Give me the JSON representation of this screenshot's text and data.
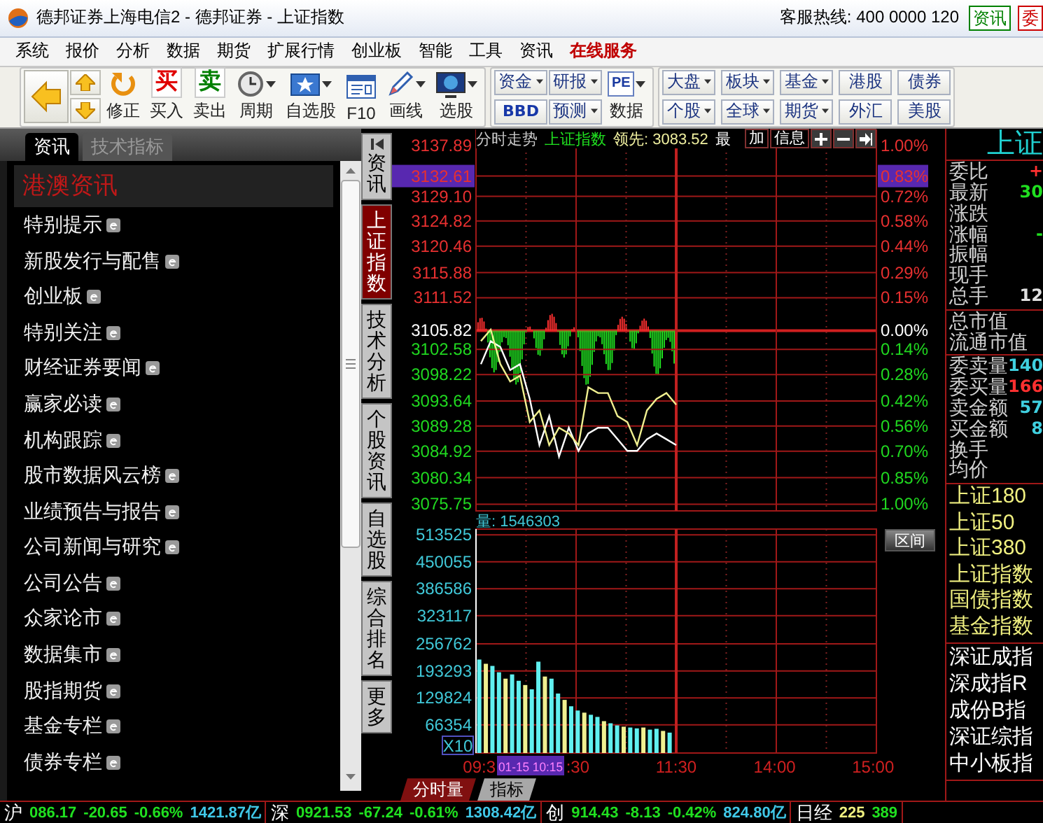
{
  "window": {
    "title": "德邦证券上海电信2 - 德邦证券 - 上证指数",
    "hotline": "客服热线: 400 0000 120",
    "buttons": [
      {
        "label": "资讯",
        "color": "#008000"
      },
      {
        "label": "委",
        "color": "#cc0000"
      }
    ]
  },
  "menu": [
    {
      "label": "系统",
      "highlighted": false
    },
    {
      "label": "报价",
      "highlighted": false
    },
    {
      "label": "分析",
      "highlighted": false
    },
    {
      "label": "数据",
      "highlighted": false
    },
    {
      "label": "期货",
      "highlighted": false
    },
    {
      "label": "扩展行情",
      "highlighted": false
    },
    {
      "label": "创业板",
      "highlighted": false
    },
    {
      "label": "智能",
      "highlighted": false
    },
    {
      "label": "工具",
      "highlighted": false
    },
    {
      "label": "资讯",
      "highlighted": false
    },
    {
      "label": "在线服务",
      "highlighted": true
    }
  ],
  "toolbar": {
    "tools": [
      {
        "kind": "back"
      },
      {
        "kind": "updown"
      },
      {
        "kind": "refresh",
        "label": "修正",
        "dropdown": false
      },
      {
        "kind": "buy",
        "glyph": "买",
        "label": "买入",
        "dropdown": false
      },
      {
        "kind": "sell",
        "glyph": "卖",
        "label": "卖出",
        "dropdown": false
      },
      {
        "kind": "clock",
        "label": "周期",
        "dropdown": true
      },
      {
        "kind": "star",
        "label": "自选股",
        "dropdown": true
      },
      {
        "kind": "doc",
        "label": "F10",
        "dropdown": false
      },
      {
        "kind": "pencil",
        "label": "画线",
        "dropdown": true
      },
      {
        "kind": "screen",
        "label": "选股",
        "dropdown": true
      }
    ],
    "small": [
      [
        {
          "label": "资金",
          "dropdown": true,
          "bold": false
        },
        {
          "label": "BBD",
          "dropdown": false,
          "bold": true
        }
      ],
      [
        {
          "label": "研报",
          "dropdown": true,
          "bold": false
        },
        {
          "label": "预测",
          "dropdown": true,
          "bold": false
        }
      ]
    ],
    "data_tool": {
      "glyph": "PE",
      "label": "数据",
      "dropdown": true
    },
    "markets": [
      [
        {
          "label": "大盘",
          "dropdown": true,
          "bold": false
        },
        {
          "label": "个股",
          "dropdown": true,
          "bold": false
        }
      ],
      [
        {
          "label": "板块",
          "dropdown": true,
          "bold": false
        },
        {
          "label": "全球",
          "dropdown": true,
          "bold": false
        }
      ],
      [
        {
          "label": "基金",
          "dropdown": true,
          "bold": false
        },
        {
          "label": "期货",
          "dropdown": true,
          "bold": false
        }
      ],
      [
        {
          "label": "港股",
          "dropdown": false,
          "bold": false
        },
        {
          "label": "外汇",
          "dropdown": false,
          "bold": false
        }
      ],
      [
        {
          "label": "债券",
          "dropdown": false,
          "bold": false
        },
        {
          "label": "美股",
          "dropdown": false,
          "bold": false
        }
      ]
    ]
  },
  "left_panel": {
    "tabs": [
      {
        "label": "资讯",
        "selected": true
      },
      {
        "label": "技术指标",
        "selected": false
      }
    ],
    "section_title": "港澳资讯",
    "items": [
      "特别提示",
      "新股发行与配售",
      "创业板",
      "特别关注",
      "财经证券要闻",
      "赢家必读",
      "机构跟踪",
      "股市数据风云榜",
      "业绩预告与报告",
      "公司新闻与研究",
      "公司公告",
      "众家论市",
      "数据集市",
      "股指期货",
      "基金专栏",
      "债券专栏"
    ]
  },
  "side_tabs": [
    {
      "label": "资讯",
      "selected": false
    },
    {
      "label": "上证指数",
      "selected": true
    },
    {
      "label": "技术分析",
      "selected": false
    },
    {
      "label": "个股资讯",
      "selected": false
    },
    {
      "label": "自选股",
      "selected": false
    },
    {
      "label": "综合排名",
      "selected": false
    },
    {
      "label": "更多",
      "selected": false
    }
  ],
  "chart": {
    "header": {
      "title": "分时走势",
      "index_name": "上证指数",
      "lead": "领先: 3083.52",
      "latest": "最"
    },
    "buttons": [
      {
        "kind": "text",
        "label": "加"
      },
      {
        "kind": "text",
        "label": "信息"
      },
      {
        "kind": "plus"
      },
      {
        "kind": "minus"
      },
      {
        "kind": "end"
      }
    ],
    "chart_data": {
      "type": "line",
      "categories": [
        null,
        null,
        null,
        null,
        null,
        null,
        null,
        null,
        null,
        null,
        null,
        null,
        null,
        null,
        null,
        null,
        null,
        null,
        null,
        null,
        null,
        null,
        null,
        null,
        null,
        null,
        null,
        null,
        null,
        null,
        null,
        null,
        null,
        null,
        null,
        null,
        null,
        null,
        null,
        null,
        null
      ],
      "ylim": [
        3074.59,
        3140.56
      ],
      "grid": true,
      "yticks": [
        {
          "value": 3137.89,
          "label": "3137.89"
        },
        {
          "value": 3132.61,
          "label": "3132.61"
        },
        {
          "value": 3129.1,
          "label": "3129.10"
        },
        {
          "value": 3124.82,
          "label": "3124.82"
        },
        {
          "value": 3120.46,
          "label": "3120.46"
        },
        {
          "value": 3115.88,
          "label": "3115.88"
        },
        {
          "value": 3111.52,
          "label": "3111.52"
        },
        {
          "value": 3105.82,
          "label": "3105.82"
        },
        {
          "value": 3102.58,
          "label": "3102.58"
        },
        {
          "value": 3098.22,
          "label": "3098.22"
        },
        {
          "value": 3093.64,
          "label": "3093.64"
        },
        {
          "value": 3089.28,
          "label": "3089.28"
        },
        {
          "value": 3084.92,
          "label": "3084.92"
        },
        {
          "value": 3080.34,
          "label": "3080.34"
        },
        {
          "value": 3075.75,
          "label": "3075.75"
        }
      ],
      "series": [
        {
          "color": "#ffffff",
          "values": [
            3100,
            3104,
            3103,
            3099,
            3100,
            3094,
            3086,
            3091,
            3084,
            3089,
            3085,
            3088,
            3089,
            3089,
            3087,
            3085,
            3085,
            3087,
            3088,
            3087,
            3086,
            null,
            null,
            null,
            null,
            null,
            null,
            null,
            null,
            null,
            null,
            null,
            null,
            null,
            null,
            null,
            null,
            null,
            null,
            null,
            null
          ]
        },
        {
          "color": "#f0f090",
          "values": [
            3104,
            3106,
            3100,
            3097,
            3098,
            3090,
            3092,
            3086,
            3089,
            3088,
            3086,
            3096,
            3095,
            3095,
            3091,
            3090,
            3086,
            3092,
            3094,
            3095,
            3093,
            null,
            null,
            null,
            null,
            null,
            null,
            null,
            null,
            null,
            null,
            null,
            null,
            null,
            null,
            null,
            null,
            null,
            null,
            null,
            null
          ]
        }
      ]
    },
    "percent_labels": [
      {
        "text": "1.00%",
        "kind": "up",
        "selected": false
      },
      {
        "text": "0.83%",
        "kind": "up",
        "selected": true
      },
      {
        "text": "0.72%",
        "kind": "up",
        "selected": false
      },
      {
        "text": "0.58%",
        "kind": "up",
        "selected": false
      },
      {
        "text": "0.44%",
        "kind": "up",
        "selected": false
      },
      {
        "text": "0.29%",
        "kind": "up",
        "selected": false
      },
      {
        "text": "0.15%",
        "kind": "up",
        "selected": false
      },
      {
        "text": "0.00%",
        "kind": "flat",
        "selected": false
      },
      {
        "text": "0.14%",
        "kind": "down",
        "selected": false
      },
      {
        "text": "0.28%",
        "kind": "down",
        "selected": false
      },
      {
        "text": "0.42%",
        "kind": "down",
        "selected": false
      },
      {
        "text": "0.56%",
        "kind": "down",
        "selected": false
      },
      {
        "text": "0.70%",
        "kind": "down",
        "selected": false
      },
      {
        "text": "0.85%",
        "kind": "down",
        "selected": false
      },
      {
        "text": "1.00%",
        "kind": "down",
        "selected": false
      }
    ],
    "volume": {
      "title": "量: 1546303",
      "scale": "X10",
      "range_button": "区间",
      "chart_data": {
        "type": "bar",
        "grid": true,
        "categories": [
          "09:3",
          null,
          null,
          null,
          null,
          null,
          null,
          null,
          null,
          null,
          null,
          null,
          null,
          null,
          null,
          ":30",
          null,
          null,
          null,
          null,
          null,
          null,
          null,
          null,
          null,
          null,
          null,
          null,
          null,
          null,
          "11:30",
          null,
          null,
          null,
          null,
          null,
          null,
          null,
          null,
          null,
          null,
          null,
          null,
          null,
          null,
          "14:00",
          null,
          null,
          null,
          null,
          null,
          null,
          null,
          null,
          null,
          null,
          null,
          null,
          null,
          null,
          "15:00"
        ],
        "values": [
          220000,
          210000,
          205000,
          190000,
          175000,
          185000,
          170000,
          160000,
          150000,
          215000,
          180000,
          175000,
          140000,
          125000,
          110000,
          100000,
          95000,
          90000,
          85000,
          75000,
          70000,
          65000,
          62000,
          60000,
          58000,
          60000,
          55000,
          57000,
          52000,
          48000,
          null,
          null,
          null,
          null,
          null,
          null,
          null,
          null,
          null,
          null,
          null,
          null,
          null,
          null,
          null,
          null,
          null,
          null,
          null,
          null,
          null,
          null,
          null,
          null,
          null,
          null,
          null,
          null,
          null,
          null,
          null
        ],
        "ylim": [
          0,
          527000
        ],
        "yticks": [
          {
            "value": 513525,
            "label": "513525"
          },
          {
            "value": 450055,
            "label": "450055"
          },
          {
            "value": 386586,
            "label": "386586"
          },
          {
            "value": 323117,
            "label": "323117"
          },
          {
            "value": 256762,
            "label": "256762"
          },
          {
            "value": 193293,
            "label": "193293"
          },
          {
            "value": 129824,
            "label": "129824"
          },
          {
            "value": 66354,
            "label": "66354"
          }
        ]
      },
      "cursor_time": "01-15 10:15"
    },
    "tabs": [
      {
        "label": "分时量",
        "selected": true
      },
      {
        "label": "指标",
        "selected": false
      }
    ]
  },
  "quote_panel": {
    "title": "上证",
    "groups": [
      {
        "rows": [
          {
            "label": "委比",
            "value": "+",
            "color": "#ff3030"
          },
          {
            "label": "最新",
            "value": "30",
            "color": "#20e020"
          },
          {
            "label": "涨跌"
          },
          {
            "label": "涨幅",
            "value": "-",
            "color": "#20e020"
          },
          {
            "label": "振幅"
          },
          {
            "label": "现手"
          },
          {
            "label": "总手",
            "value": "12",
            "color": "#e0e0e0"
          }
        ]
      },
      {
        "rows": [
          {
            "label": "总市值"
          },
          {
            "label": "流通市值"
          }
        ]
      },
      {
        "rows": [
          {
            "label": "委卖量",
            "value": "140",
            "color": "#40d0e0"
          },
          {
            "label": "委买量",
            "value": "166",
            "color": "#ff3030"
          },
          {
            "label": "卖金额",
            "value": "57",
            "color": "#40d0e0"
          },
          {
            "label": "买金额",
            "value": "8",
            "color": "#40d0e0"
          },
          {
            "label": "换手"
          },
          {
            "label": "均价"
          }
        ]
      }
    ],
    "index_groups": [
      {
        "color": "#f0f080",
        "items": [
          "上证180",
          "上证50",
          "上证380",
          "上证指数",
          "国债指数",
          "基金指数"
        ]
      },
      {
        "color": "#ffffff",
        "items": [
          "深证成指",
          "深成指R",
          "成份B指",
          "深证综指",
          "中小板指"
        ]
      }
    ]
  },
  "ticker": [
    {
      "name": "沪",
      "values": [
        {
          "text": "086.17",
          "color": "#20e020"
        },
        {
          "text": "-20.65",
          "color": "#20e020"
        },
        {
          "text": "-0.66%",
          "color": "#20e020"
        },
        {
          "text": "1421.87亿",
          "color": "#40c8e8"
        }
      ]
    },
    {
      "name": "深",
      "values": [
        {
          "text": "0921.53",
          "color": "#20e020"
        },
        {
          "text": "-67.24",
          "color": "#20e020"
        },
        {
          "text": "-0.61%",
          "color": "#20e020"
        },
        {
          "text": "1308.42亿",
          "color": "#40c8e8"
        }
      ]
    },
    {
      "name": "创",
      "values": [
        {
          "text": "914.43",
          "color": "#20e020"
        },
        {
          "text": "-8.13",
          "color": "#20e020"
        },
        {
          "text": "-0.42%",
          "color": "#20e020"
        },
        {
          "text": "824.80亿",
          "color": "#40c8e8"
        }
      ]
    },
    {
      "name": "日经",
      "values": [
        {
          "text": "225",
          "color": "#f0f080"
        },
        {
          "text": "389",
          "color": "#20e020"
        }
      ]
    }
  ]
}
